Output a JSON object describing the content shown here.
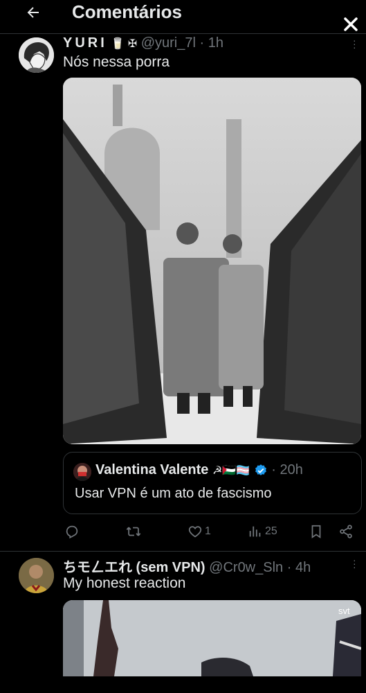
{
  "header": {
    "title": "Comentários",
    "back_icon": "arrow-left-icon",
    "close_icon": "close-icon"
  },
  "reply1": {
    "name": "YURI",
    "name_badges": "🥛 ✠",
    "handle": "@yuri_7l",
    "separator": "·",
    "time": "1h",
    "text": "Nós nessa porra",
    "quote": {
      "name": "Valentina Valente",
      "flags": "☭🇵🇸🏳️‍⚧️",
      "time": "20h",
      "text": "Usar VPN é um ato de fascismo"
    },
    "actions": {
      "likes": "1",
      "views": "25"
    }
  },
  "reply2": {
    "name": "ちモㄥエれ (sem VPN)",
    "handle": "@Cr0w_Sln",
    "separator": "·",
    "time": "4h",
    "text": "My honest reaction",
    "watermark": "svt"
  },
  "colors": {
    "background": "#000000",
    "text": "#e7e9ea",
    "muted": "#71767b",
    "border": "#2f3336",
    "verified": "#1d9bf0"
  }
}
